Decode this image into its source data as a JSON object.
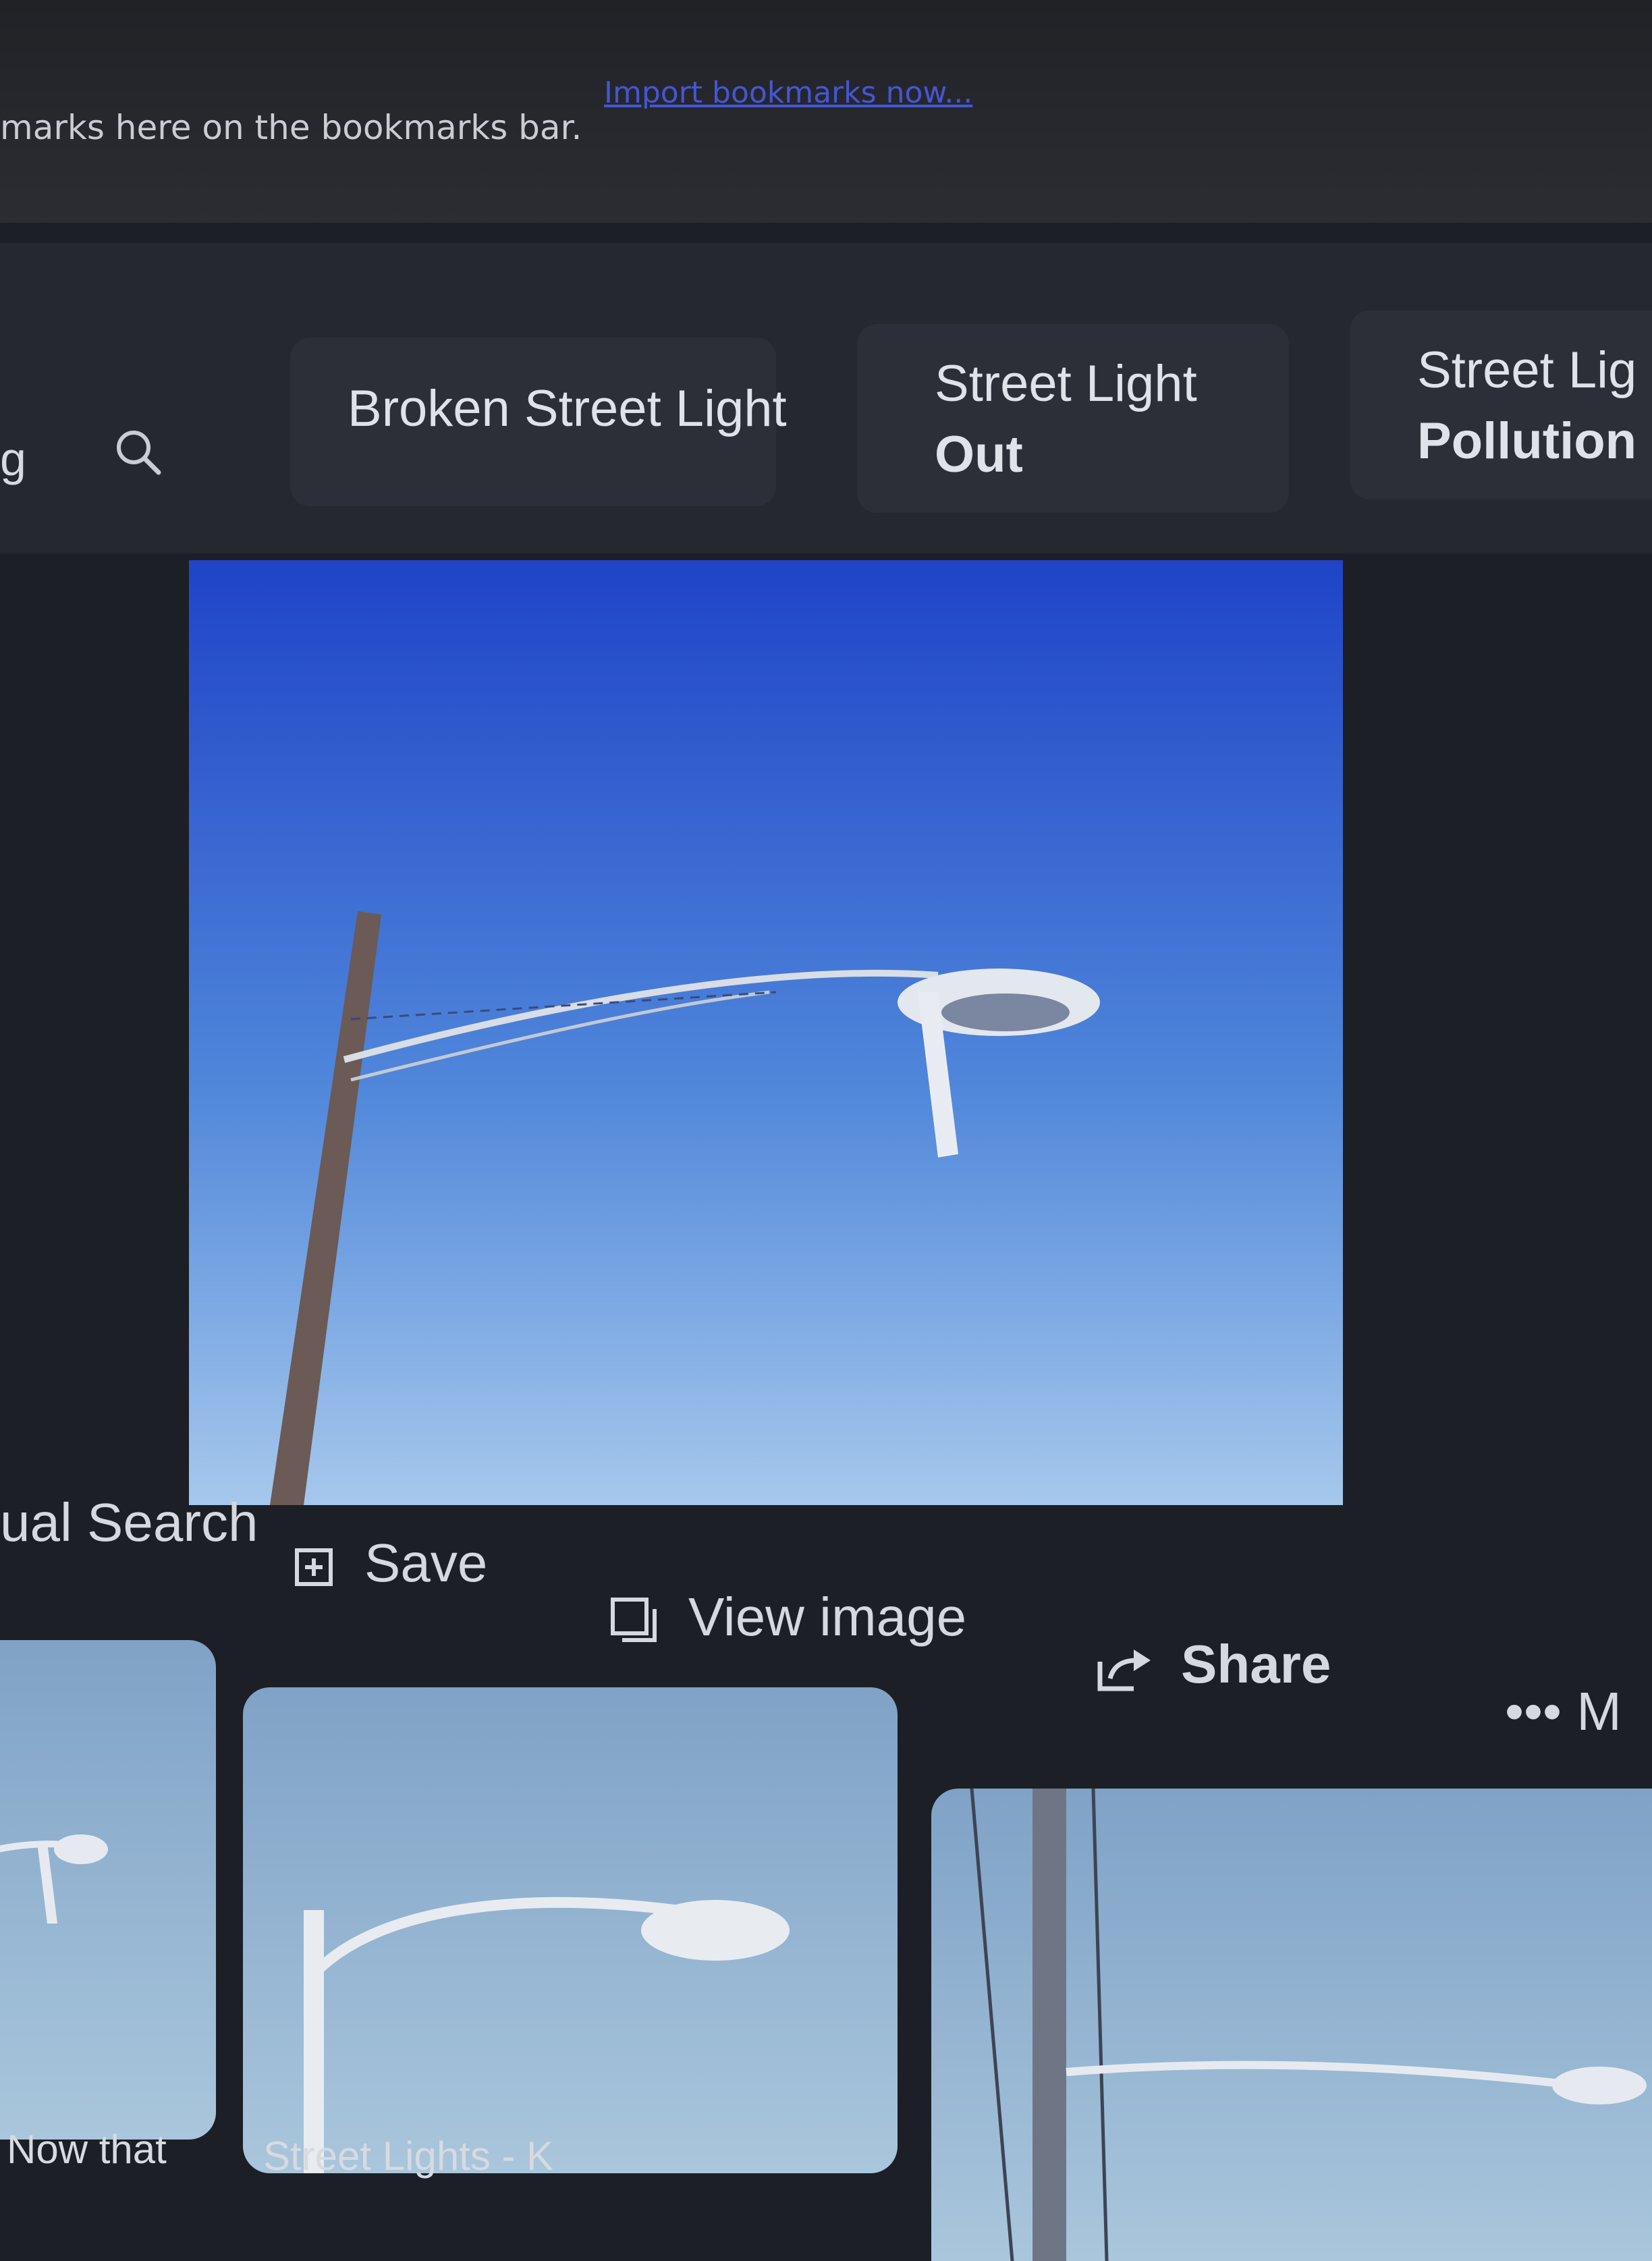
{
  "bookmarks_bar": {
    "prompt_text": "marks here on the bookmarks bar.",
    "import_link": "Import bookmarks now..."
  },
  "search": {
    "query_fragment": "g"
  },
  "related": [
    {
      "line1": "Broken Street Light",
      "line2": ""
    },
    {
      "line1": "Street Light",
      "line2": "Out"
    },
    {
      "line1": "Street Lig",
      "line2": "Pollution"
    }
  ],
  "actions": {
    "visual_search": "ual Search",
    "save": "Save",
    "view_image": "View image",
    "share": "Share",
    "more": "M"
  },
  "thumbnails": [
    {
      "caption": "Now that"
    },
    {
      "caption": "Street Lights - K"
    },
    {
      "caption": ""
    }
  ],
  "colors": {
    "sky_top": "#1f44c8",
    "sky_bottom": "#a6c8ec",
    "link": "#4b5ff0",
    "background": "#1c1f26"
  },
  "icons": [
    "search-icon",
    "save-icon",
    "view-image-icon",
    "share-icon",
    "more-icon"
  ]
}
